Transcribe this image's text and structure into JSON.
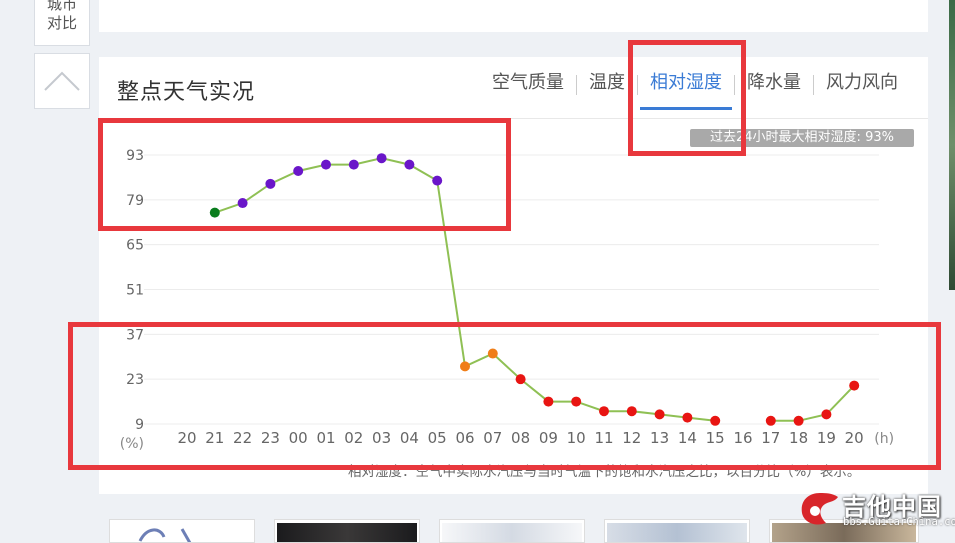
{
  "sidebar": {
    "city_compare_line1": "城市",
    "city_compare_line2": "对比"
  },
  "panel": {
    "title": "整点天气实况",
    "tabs": [
      {
        "label": "空气质量",
        "active": false
      },
      {
        "label": "温度",
        "active": false
      },
      {
        "label": "相对湿度",
        "active": true
      },
      {
        "label": "降水量",
        "active": false
      },
      {
        "label": "风力风向",
        "active": false
      }
    ],
    "max_badge": "过去24小时最大相对湿度: 93%",
    "note": "相对湿度：空气中实际水汽压与当时气温下的饱和水汽压之比，以百分比（%）表示。"
  },
  "watermark": {
    "text": "吉他中国",
    "sub": "bbs.GuitarChina.com"
  },
  "colors": {
    "line": "#8fc054",
    "accent": "#3a7bd5",
    "annotation": "#e8383d",
    "very_humid": "#6a16c9",
    "humid": "#0a7d1e",
    "moderate": "#f07e18",
    "dry": "#e81512"
  },
  "chart_data": {
    "type": "line",
    "y_ticks": [
      "93",
      "79",
      "65",
      "51",
      "37",
      "23",
      "9"
    ],
    "y_unit": "(%)",
    "x_unit": "(h)",
    "categories": [
      "20",
      "21",
      "22",
      "23",
      "00",
      "01",
      "02",
      "03",
      "04",
      "05",
      "06",
      "07",
      "08",
      "09",
      "10",
      "11",
      "12",
      "13",
      "14",
      "15",
      "16",
      "17",
      "18",
      "19",
      "20"
    ],
    "values": [
      null,
      75,
      78,
      84,
      88,
      90,
      90,
      92,
      90,
      85,
      27,
      31,
      23,
      16,
      16,
      13,
      13,
      12,
      11,
      10,
      null,
      10,
      10,
      12,
      21
    ],
    "ylim": [
      9,
      93
    ],
    "point_colors": [
      null,
      "#0a7d1e",
      "#6a16c9",
      "#6a16c9",
      "#6a16c9",
      "#6a16c9",
      "#6a16c9",
      "#6a16c9",
      "#6a16c9",
      "#6a16c9",
      "#f07e18",
      "#f07e18",
      "#e81512",
      "#e81512",
      "#e81512",
      "#e81512",
      "#e81512",
      "#e81512",
      "#e81512",
      "#e81512",
      null,
      "#e81512",
      "#e81512",
      "#e81512",
      "#e81512"
    ]
  }
}
